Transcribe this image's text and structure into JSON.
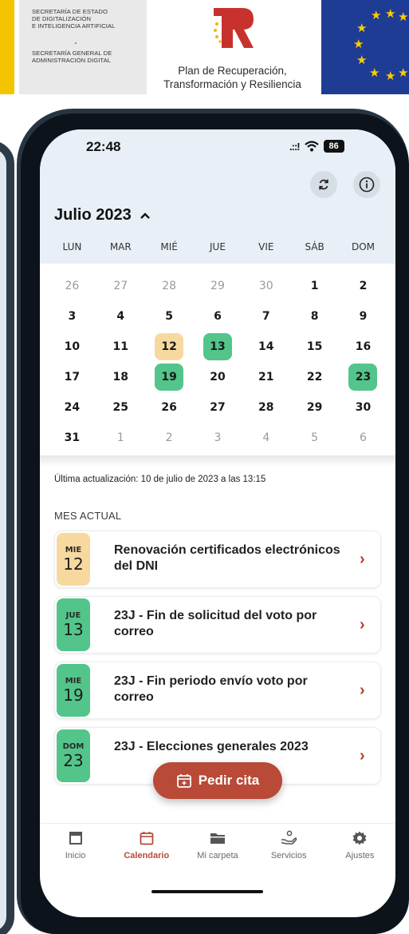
{
  "banner": {
    "gov_line1": "SECRETARÍA DE ESTADO",
    "gov_line2": "DE DIGITALIZACIÓN",
    "gov_line3": "E INTELIGENCIA ARTIFICIAL",
    "gov_line4": "SECRETARÍA GENERAL DE",
    "gov_line5": "ADMINISTRACIÓN DIGITAL",
    "plan_line1": "Plan de Recuperación,",
    "plan_line2": "Transformación y Resiliencia"
  },
  "status_bar": {
    "time": "22:48",
    "battery": "86"
  },
  "calendar": {
    "month_title": "Julio 2023",
    "weekdays": [
      "LUN",
      "MAR",
      "MIÉ",
      "JUE",
      "VIE",
      "SÁB",
      "DOM"
    ],
    "weeks": [
      [
        "26",
        "27",
        "28",
        "29",
        "30",
        "1",
        "2"
      ],
      [
        "3",
        "4",
        "5",
        "6",
        "7",
        "8",
        "9"
      ],
      [
        "10",
        "11",
        "12",
        "13",
        "14",
        "15",
        "16"
      ],
      [
        "17",
        "18",
        "19",
        "20",
        "21",
        "22",
        "23"
      ],
      [
        "24",
        "25",
        "26",
        "27",
        "28",
        "29",
        "30"
      ],
      [
        "31",
        "1",
        "2",
        "3",
        "4",
        "5",
        "6"
      ]
    ],
    "muted_days": [
      "0-0",
      "0-1",
      "0-2",
      "0-3",
      "0-4",
      "5-1",
      "5-2",
      "5-3",
      "5-4",
      "5-5",
      "5-6"
    ],
    "highlighted_days": {
      "2-2": "yellow",
      "2-3": "green",
      "3-2": "green",
      "3-6": "green"
    }
  },
  "last_update": "Última actualización: 10 de julio de 2023 a las 13:15",
  "section_title": "MES ACTUAL",
  "events": [
    {
      "weekday": "MIE",
      "day": "12",
      "title": "Renovación certificados electrónicos del DNI",
      "color": "yellow"
    },
    {
      "weekday": "JUE",
      "day": "13",
      "title": "23J - Fin de solicitud del voto por correo",
      "color": "green"
    },
    {
      "weekday": "MIE",
      "day": "19",
      "title": "23J - Fin periodo envío voto por correo",
      "color": "green"
    },
    {
      "weekday": "DOM",
      "day": "23",
      "title": "23J - Elecciones generales 2023",
      "color": "green"
    }
  ],
  "cta": {
    "label": "Pedir cita"
  },
  "tabs": [
    {
      "label": "Inicio",
      "icon": "home-icon"
    },
    {
      "label": "Calendario",
      "icon": "calendar-icon",
      "active": true
    },
    {
      "label": "Mi carpeta",
      "icon": "folder-icon"
    },
    {
      "label": "Servicios",
      "icon": "services-icon"
    },
    {
      "label": "Ajustes",
      "icon": "gear-icon"
    }
  ],
  "colors": {
    "accent": "#b84a37",
    "green": "#53c58a",
    "yellow": "#f7d9a0",
    "header_bg": "#e8eff6"
  }
}
